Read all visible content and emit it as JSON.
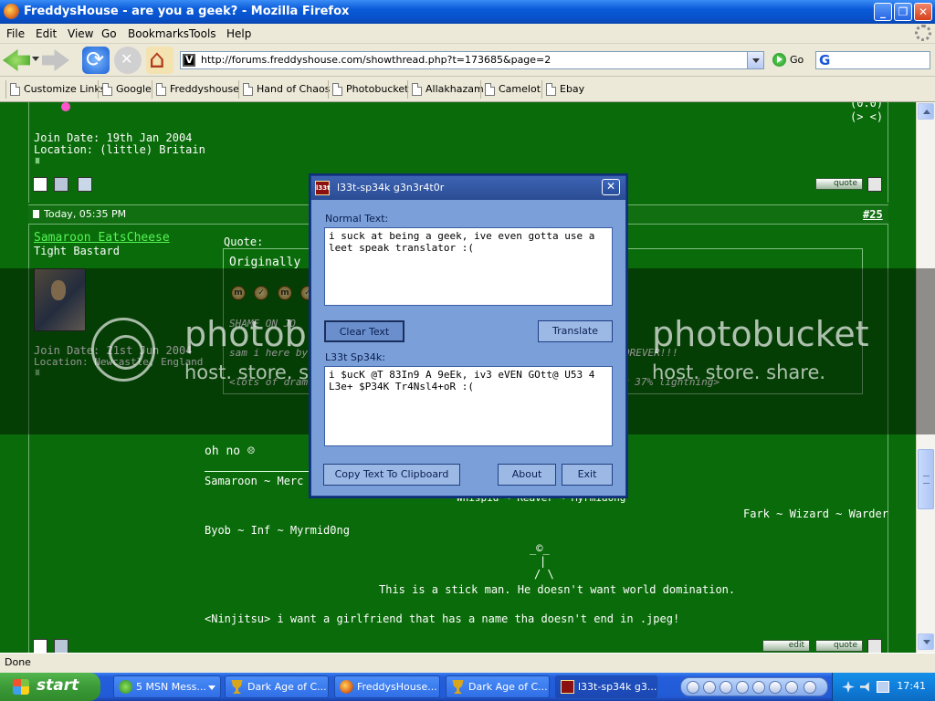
{
  "window": {
    "title": "FreddysHouse - are you a geek? - Mozilla Firefox",
    "minimize_glyph": "_",
    "maximize_glyph": "❐",
    "close_glyph": "✕"
  },
  "menu": [
    "File",
    "Edit",
    "View",
    "Go",
    "Bookmarks",
    "Tools",
    "Help"
  ],
  "nav": {
    "url": "http://forums.freddyshouse.com/showthread.php?t=173685&page=2",
    "go_label": "Go",
    "search_logo": "G"
  },
  "bookmarks": [
    "Customize Links",
    "Google",
    "Freddyshouse",
    "Hand of Chaos",
    "Photobucket",
    "Allakhazam",
    "Camelot",
    "Ebay"
  ],
  "prev_post": {
    "join_date": "Join Date: 19th Jan 2004",
    "location": "Location: (little) Britain",
    "sig_line1": "(0.0)",
    "sig_line2": "(> <)",
    "quote_label": "quote"
  },
  "post": {
    "timestamp": "Today, 05:35 PM",
    "number": "#25",
    "username": "Samaroon EatsCheese",
    "user_title": "Tight Bastard",
    "join_date": "Join Date: 21st Jun 2004",
    "location": "Location: Newcastle, England",
    "quote_label": "Quote:",
    "originally_posted": "Originally Pos",
    "quote_line1": "SHAME ON JO",
    "quote_line2": "sam i here by",
    "quote_line2_tail": "OREVER!!!",
    "quote_line3": "<lots of dram",
    "quote_line3_tail": "r 37% lightning>",
    "body": "oh no ☹",
    "sig_line1": "Samaroon ~ Merc ~",
    "sig_line2": "Whispid ~ Reaver ~ Myrmid0ng",
    "sig_line3": "Fark ~ Wizard ~ Warder",
    "sig_line4": "Byob ~ Inf ~ Myrmid0ng",
    "stickman_head": "_©_",
    "stickman_body": "|",
    "stickman_legs": "/ \\",
    "stickman_caption": "This is a stick man. He doesn't want world domination.",
    "quote_text": "<Ninjitsu> i want a girlfriend that has a name tha doesn't end in .jpeg!",
    "edit_label": "edit",
    "quote_btn_label": "quote",
    "coins": [
      "m",
      "✓",
      "m",
      "✓"
    ]
  },
  "dialog": {
    "title": "l33t-sp34k g3n3r4t0r",
    "icon_text": "l33t",
    "normal_label": "Normal Text:",
    "normal_text": "i suck at being a geek, ive even gotta use a leet speak translator :(",
    "clear_label": "Clear Text",
    "translate_label": "Translate",
    "leet_label": "L33t Sp34k:",
    "leet_text": "i $ucK @T 83In9 A 9eEk, iv3 eVEN GOtt@ U53 4 L3e+ $P34K Tr4Nsl4+oR :(",
    "copy_label": "Copy Text To Clipboard",
    "about_label": "About",
    "exit_label": "Exit",
    "close_glyph": "✕"
  },
  "watermark": {
    "brand": "photobucket",
    "tagline": "host. store. share."
  },
  "status": "Done",
  "taskbar": {
    "start_label": "start",
    "tasks": [
      "5 MSN Mess...",
      "Dark Age of C...",
      "FreddysHouse...",
      "Dark Age of C...",
      "l33t-sp34k g3..."
    ],
    "clock": "17:41"
  }
}
